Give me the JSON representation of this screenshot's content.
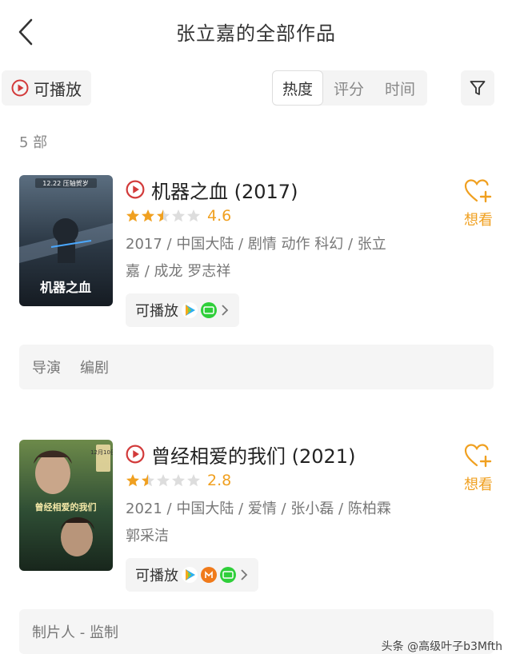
{
  "header": {
    "title": "张立嘉的全部作品"
  },
  "toolbar": {
    "playable_label": "可播放",
    "sort_tabs": [
      {
        "label": "热度",
        "active": true
      },
      {
        "label": "评分",
        "active": false
      },
      {
        "label": "时间",
        "active": false
      }
    ]
  },
  "count_text": "5 部",
  "works": [
    {
      "title": "机器之血 (2017)",
      "score": "4.6",
      "stars_filled": 2.5,
      "meta": "2017 / 中国大陆 / 剧情 动作 科幻 / 张立嘉 / 成龙 罗志祥",
      "play_label": "可播放",
      "sources": [
        "tencent-video-icon",
        "iqiyi-icon"
      ],
      "want_label": "想看",
      "roles": [
        "导演",
        "编剧"
      ],
      "poster_colors": [
        "#3a4a58",
        "#1c2530"
      ],
      "poster_text": "机器之血",
      "poster_top_text": "12.22 压轴贺岁"
    },
    {
      "title": "曾经相爱的我们 (2021)",
      "score": "2.8",
      "stars_filled": 1.5,
      "meta": "2021 / 中国大陆 / 爱情 / 张小磊 / 陈柏霖 郭采洁",
      "play_label": "可播放",
      "sources": [
        "tencent-video-icon",
        "mango-tv-icon",
        "iqiyi-icon"
      ],
      "want_label": "想看",
      "roles": [
        "制片人 - 监制"
      ],
      "poster_colors": [
        "#5a7a3a",
        "#1f3a28"
      ],
      "poster_text": "曾经相爱的我们",
      "poster_top_text": "12月10日"
    }
  ],
  "watermark": "头条 @高级叶子b3Mfth",
  "colors": {
    "accent": "#f0a020",
    "play_red": "#d23a3a"
  }
}
